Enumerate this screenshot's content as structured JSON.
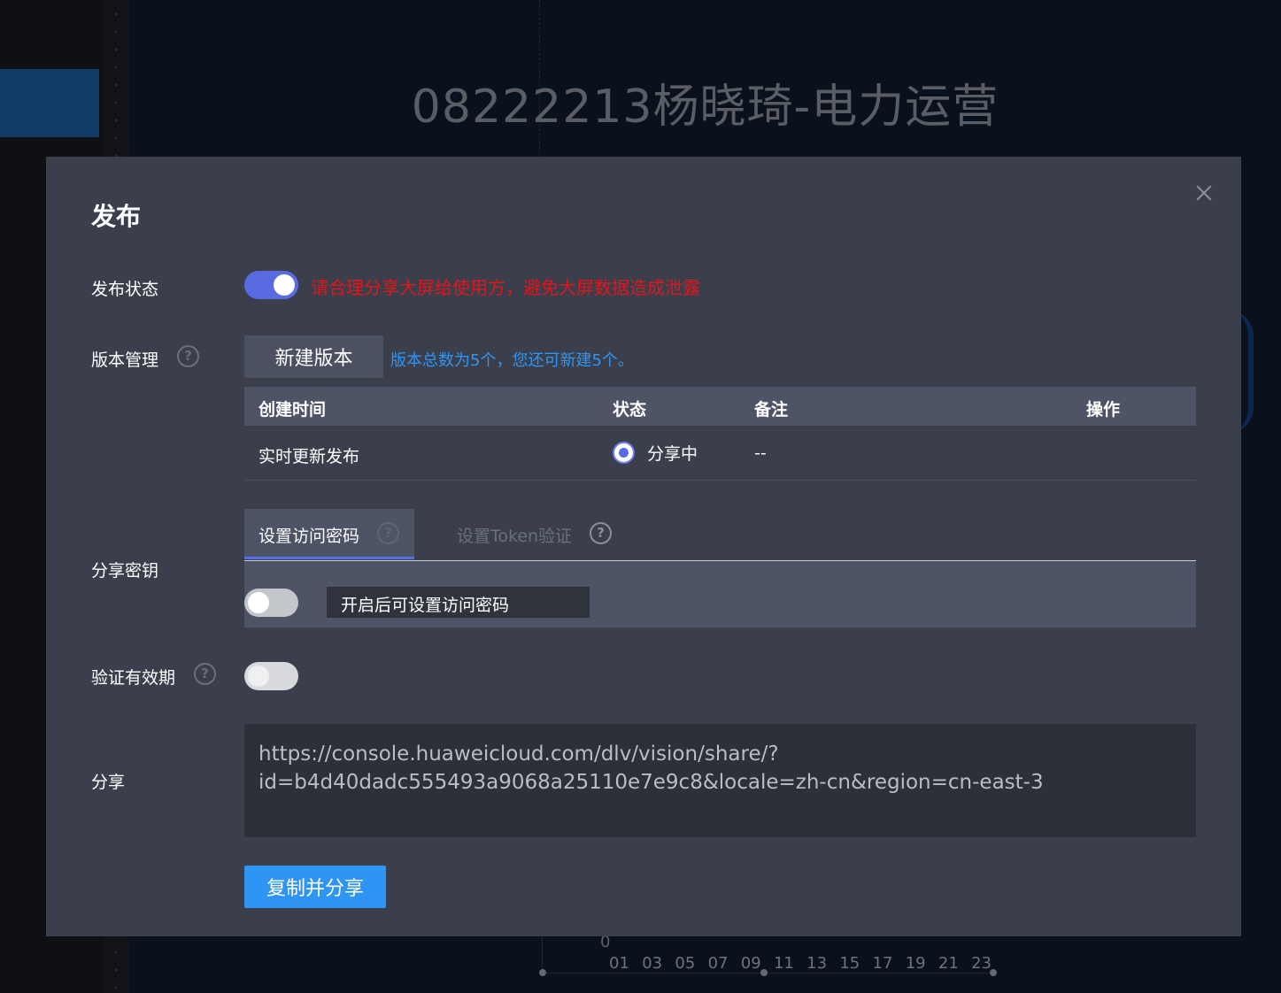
{
  "background": {
    "screen_title": "08222213杨晓琦-电力运营",
    "chart": {
      "y_zero_label": "0",
      "x_ticks": [
        "01",
        "03",
        "05",
        "07",
        "09",
        "11",
        "13",
        "15",
        "17",
        "19",
        "21",
        "23"
      ]
    }
  },
  "dialog": {
    "title": "发布",
    "publish_status": {
      "label": "发布状态",
      "enabled": true,
      "warning": "请合理分享大屏给使用方，避免大屏数据造成泄露"
    },
    "version_management": {
      "label": "版本管理",
      "new_version_button": "新建版本",
      "info": "版本总数为5个，您还可新建5个。",
      "table": {
        "columns": [
          "创建时间",
          "状态",
          "备注",
          "操作"
        ],
        "rows": [
          {
            "created": "实时更新发布",
            "status": "分享中",
            "remark": "--",
            "action": ""
          }
        ]
      }
    },
    "share_key": {
      "label": "分享密钥",
      "tabs": [
        {
          "label": "设置访问密码",
          "active": true
        },
        {
          "label": "设置Token验证",
          "active": false
        }
      ],
      "password_enabled": false,
      "password_placeholder": "开启后可设置访问密码"
    },
    "validity": {
      "label": "验证有效期",
      "enabled": false
    },
    "share": {
      "label": "分享",
      "url_line1": "https://console.huaweicloud.com/dlv/vision/share/?",
      "url_line2": "id=b4d40dadc555493a9068a25110e7e9c8&locale=zh-cn&region=cn-east-3",
      "copy_button": "复制并分享"
    }
  },
  "colors": {
    "modal_bg": "#3a3f4b",
    "accent_blue": "#2f95f5",
    "toggle_on": "#5a6ae0",
    "warning_red": "#e3141b"
  }
}
